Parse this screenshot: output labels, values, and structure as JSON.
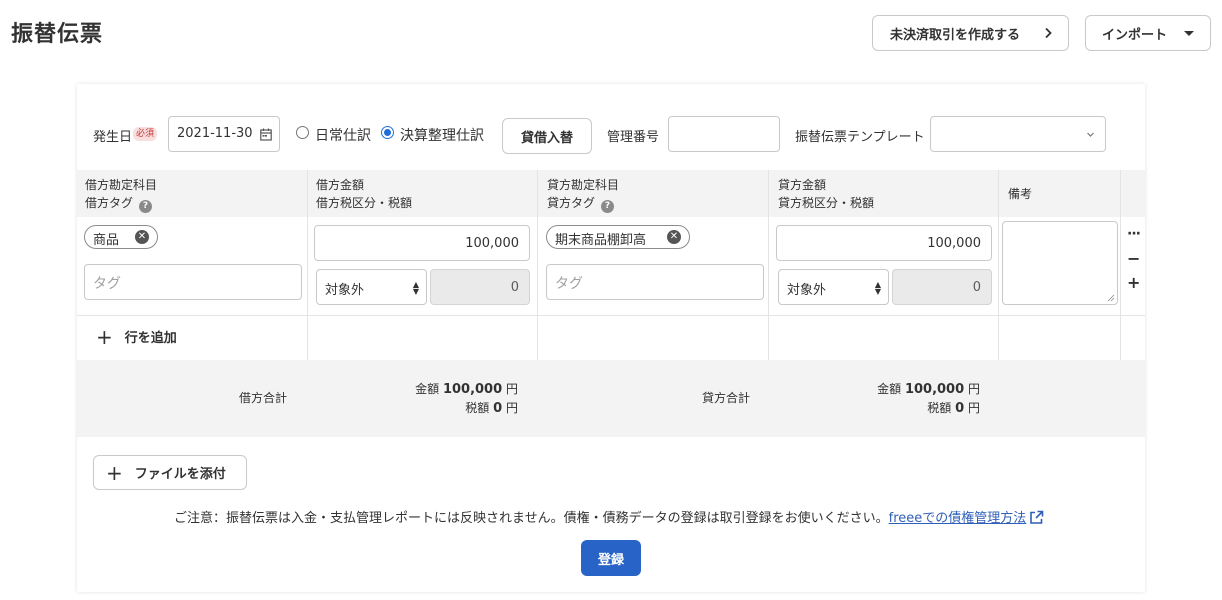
{
  "page": {
    "title": "振替伝票"
  },
  "header": {
    "create_unsettled_label": "未決済取引を作成する",
    "import_label": "インポート"
  },
  "form": {
    "date_label": "発生日",
    "required_badge": "必須",
    "date_value": "2021-11-30",
    "entry_types": [
      {
        "label": "日常仕訳",
        "checked": false
      },
      {
        "label": "決算整理仕訳",
        "checked": true
      }
    ],
    "swap_label": "貸借入替",
    "mgmt_number_label": "管理番号",
    "mgmt_number_value": "",
    "template_label": "振替伝票テンプレート",
    "template_value": ""
  },
  "table": {
    "headers": {
      "debit_account": "借方勘定科目",
      "debit_tag": "借方タグ",
      "debit_amount": "借方金額",
      "debit_tax": "借方税区分・税額",
      "credit_account": "貸方勘定科目",
      "credit_tag": "貸方タグ",
      "credit_amount": "貸方金額",
      "credit_tax": "貸方税区分・税額",
      "memo": "備考",
      "help_glyph": "?"
    },
    "rows": [
      {
        "debit_account": "商品",
        "debit_tag_placeholder": "タグ",
        "debit_amount": "100,000",
        "debit_tax_category": "対象外",
        "debit_tax_amount": "0",
        "credit_account": "期末商品棚卸高",
        "credit_tag_placeholder": "タグ",
        "credit_amount": "100,000",
        "credit_tax_category": "対象外",
        "credit_tax_amount": "0",
        "memo": "",
        "actions": {
          "more": "···",
          "remove": "−",
          "add": "+"
        }
      }
    ],
    "add_row_label": "行を追加",
    "totals": {
      "debit_label": "借方合計",
      "credit_label": "貸方合計",
      "amount_prefix": "金額",
      "tax_prefix": "税額",
      "currency": "円",
      "debit_amount": "100,000",
      "debit_tax": "0",
      "credit_amount": "100,000",
      "credit_tax": "0"
    }
  },
  "footer": {
    "attach_label": "ファイルを添付",
    "notice_text": "ご注意：振替伝票は入金・支払管理レポートには反映されません。債権・債務データの登録は取引登録をお使いください。",
    "notice_link": "freeeでの債権管理方法",
    "register_label": "登録"
  },
  "colors": {
    "primary": "#2864c8",
    "link": "#2f5fb8",
    "required": "#c23838",
    "header_bg": "#f3f3f3"
  },
  "icons": [
    "chevron-right-icon",
    "caret-down-icon",
    "calendar-icon",
    "help-icon",
    "remove-chip-icon",
    "plus-icon",
    "external-link-icon",
    "more-icon",
    "minus-icon"
  ]
}
